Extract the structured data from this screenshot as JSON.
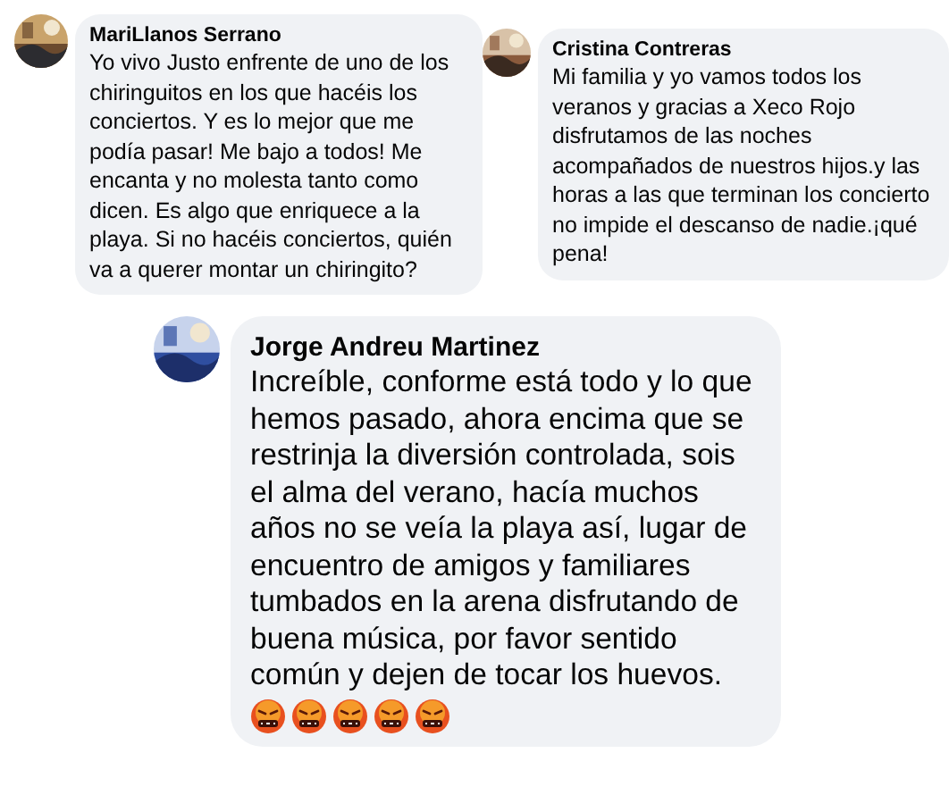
{
  "comments": [
    {
      "author": "MariLlanos Serrano",
      "text": "Yo vivo Justo enfrente de uno de los chiringuitos en los que hacéis los conciertos. Y es lo mejor que me podía pasar! Me bajo a todos! Me encanta y no molesta tanto como dicen. Es algo que enriquece a la playa. Si no hacéis conciertos, quién va a querer montar un chiringito?"
    },
    {
      "author": "Cristina Contreras",
      "text": "Mi familia y yo vamos todos los veranos y gracias a Xeco Rojo disfrutamos de las noches acompañados de nuestros hijos.y las horas a las que terminan los concierto no impide el descanso de nadie.¡qué pena!"
    },
    {
      "author": "Jorge Andreu Martinez",
      "text": "Increíble, conforme está todo y lo que hemos pasado, ahora encima que se restrinja la diversión controlada, sois el alma del verano, hacía muchos años no se veía la playa así, lugar de encuentro de amigos y familiares tumbados en la arena disfrutando de buena música, por favor sentido común y dejen de tocar los huevos.",
      "emojis": [
        {
          "kind": "swearing"
        },
        {
          "kind": "swearing"
        },
        {
          "kind": "swearing"
        },
        {
          "kind": "swearing"
        },
        {
          "kind": "swearing"
        }
      ]
    }
  ]
}
